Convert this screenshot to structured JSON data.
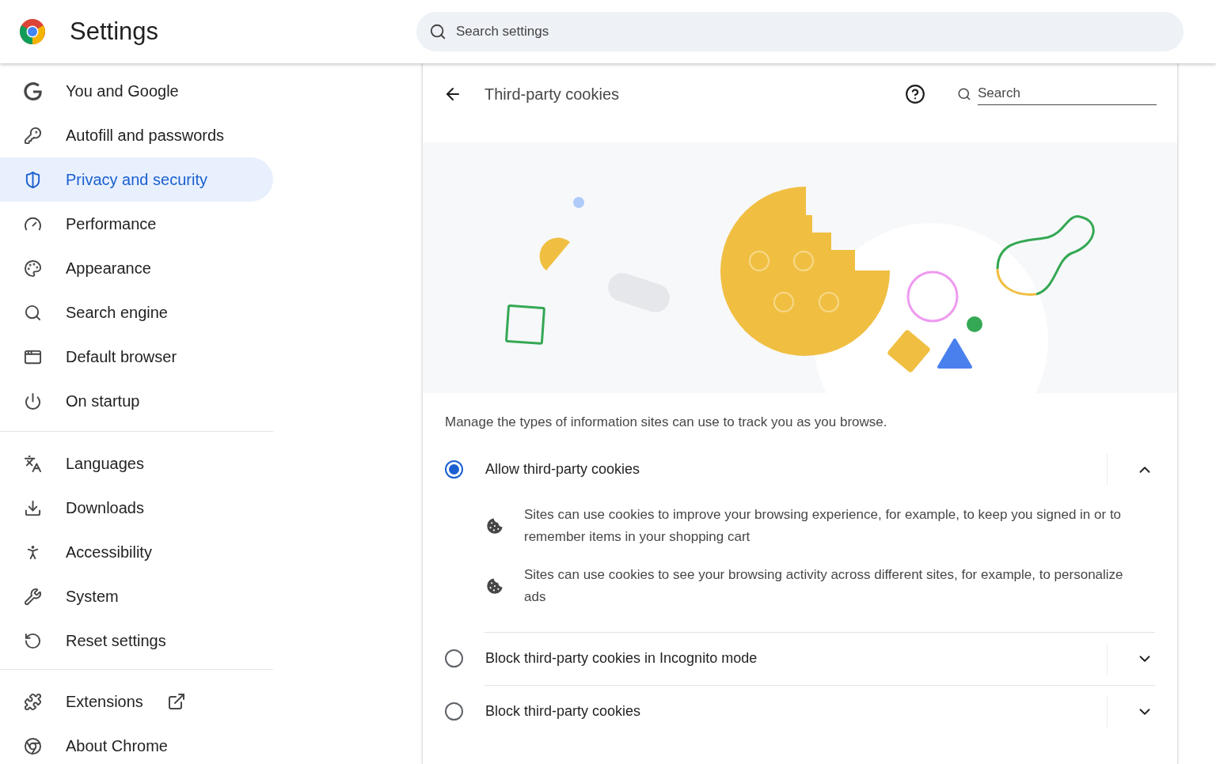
{
  "header": {
    "title": "Settings",
    "search": {
      "placeholder": "Search settings"
    }
  },
  "sidebar": {
    "groups": [
      {
        "items": [
          {
            "label": "You and Google",
            "selected": false
          },
          {
            "label": "Autofill and passwords",
            "selected": false
          },
          {
            "label": "Privacy and security",
            "selected": true
          },
          {
            "label": "Performance",
            "selected": false
          },
          {
            "label": "Appearance",
            "selected": false
          },
          {
            "label": "Search engine",
            "selected": false
          },
          {
            "label": "Default browser",
            "selected": false
          },
          {
            "label": "On startup",
            "selected": false
          }
        ]
      },
      {
        "items": [
          {
            "label": "Languages",
            "selected": false
          },
          {
            "label": "Downloads",
            "selected": false
          },
          {
            "label": "Accessibility",
            "selected": false
          },
          {
            "label": "System",
            "selected": false
          },
          {
            "label": "Reset settings",
            "selected": false
          }
        ]
      },
      {
        "items": [
          {
            "label": "Extensions",
            "selected": false,
            "external": true
          },
          {
            "label": "About Chrome",
            "selected": false
          }
        ]
      }
    ]
  },
  "page": {
    "title": "Third-party cookies",
    "search": {
      "placeholder": "Search"
    },
    "description": "Manage the types of information sites can use to track you as you browse.",
    "options": [
      {
        "label": "Allow third-party cookies",
        "selected": true,
        "expanded": true,
        "details": [
          "Sites can use cookies to improve your browsing experience, for example, to keep you signed in or to remember items in your shopping cart",
          "Sites can use cookies to see your browsing activity across different sites, for example, to personalize ads"
        ]
      },
      {
        "label": "Block third-party cookies in Incognito mode",
        "selected": false,
        "expanded": false
      },
      {
        "label": "Block third-party cookies",
        "selected": false,
        "expanded": false
      }
    ]
  }
}
